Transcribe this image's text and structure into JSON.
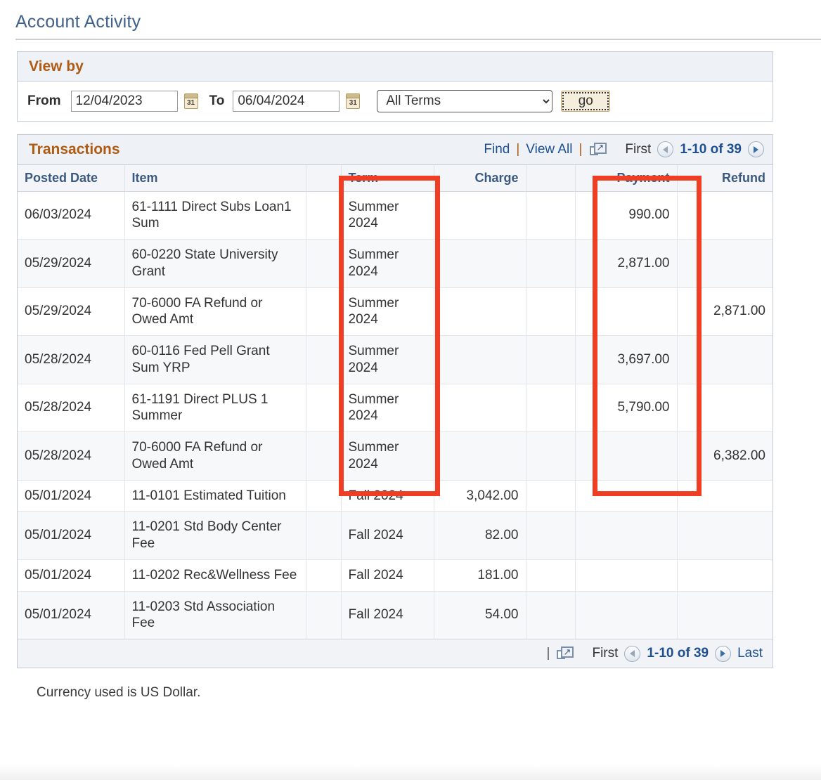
{
  "page": {
    "title": "Account Activity",
    "currency_note": "Currency used is US Dollar."
  },
  "view_by": {
    "section_title": "View by",
    "from_label": "From",
    "from_value": "12/04/2023",
    "to_label": "To",
    "to_value": "06/04/2024",
    "calendar_icon_day": "31",
    "term_selected": "All Terms",
    "term_options": [
      "All Terms"
    ],
    "go_label": "go"
  },
  "transactions": {
    "section_title": "Transactions",
    "find_label": "Find",
    "view_all_label": "View All",
    "separator": "|",
    "export_icon": "export-new-window-icon",
    "first_label": "First",
    "last_label": "Last",
    "range_label": "1-10 of 39",
    "columns": {
      "posted_date": "Posted Date",
      "item": "Item",
      "term": "Term",
      "charge": "Charge",
      "payment": "Payment",
      "refund": "Refund"
    },
    "rows": [
      {
        "date": "06/03/2024",
        "item": "61-1111 Direct Subs Loan1 Sum",
        "term": "Summer 2024",
        "charge": "",
        "payment": "990.00",
        "refund": ""
      },
      {
        "date": "05/29/2024",
        "item": "60-0220 State University Grant",
        "term": "Summer 2024",
        "charge": "",
        "payment": "2,871.00",
        "refund": ""
      },
      {
        "date": "05/29/2024",
        "item": "70-6000 FA Refund or Owed Amt",
        "term": "Summer 2024",
        "charge": "",
        "payment": "",
        "refund": "2,871.00"
      },
      {
        "date": "05/28/2024",
        "item": "60-0116 Fed Pell Grant Sum YRP",
        "term": "Summer 2024",
        "charge": "",
        "payment": "3,697.00",
        "refund": ""
      },
      {
        "date": "05/28/2024",
        "item": "61-1191 Direct PLUS 1 Summer",
        "term": "Summer 2024",
        "charge": "",
        "payment": "5,790.00",
        "refund": ""
      },
      {
        "date": "05/28/2024",
        "item": "70-6000 FA Refund or Owed Amt",
        "term": "Summer 2024",
        "charge": "",
        "payment": "",
        "refund": "6,382.00"
      },
      {
        "date": "05/01/2024",
        "item": "11-0101 Estimated Tuition",
        "term": "Fall 2024",
        "charge": "3,042.00",
        "payment": "",
        "refund": ""
      },
      {
        "date": "05/01/2024",
        "item": "11-0201 Std Body Center Fee",
        "term": "Fall 2024",
        "charge": "82.00",
        "payment": "",
        "refund": ""
      },
      {
        "date": "05/01/2024",
        "item": "11-0202 Rec&Wellness Fee",
        "term": "Fall 2024",
        "charge": "181.00",
        "payment": "",
        "refund": ""
      },
      {
        "date": "05/01/2024",
        "item": "11-0203 Std Association Fee",
        "term": "Fall 2024",
        "charge": "54.00",
        "payment": "",
        "refund": ""
      }
    ]
  },
  "annotations": {
    "color": "#ef3e23",
    "highlighted_columns": [
      "Term",
      "Payment"
    ]
  },
  "colors": {
    "title_blue": "#40618c",
    "section_orange": "#b05a12",
    "link_blue": "#1d4f91",
    "header_text_blue": "#3c5a80",
    "panel_border": "#c3ccd6"
  }
}
